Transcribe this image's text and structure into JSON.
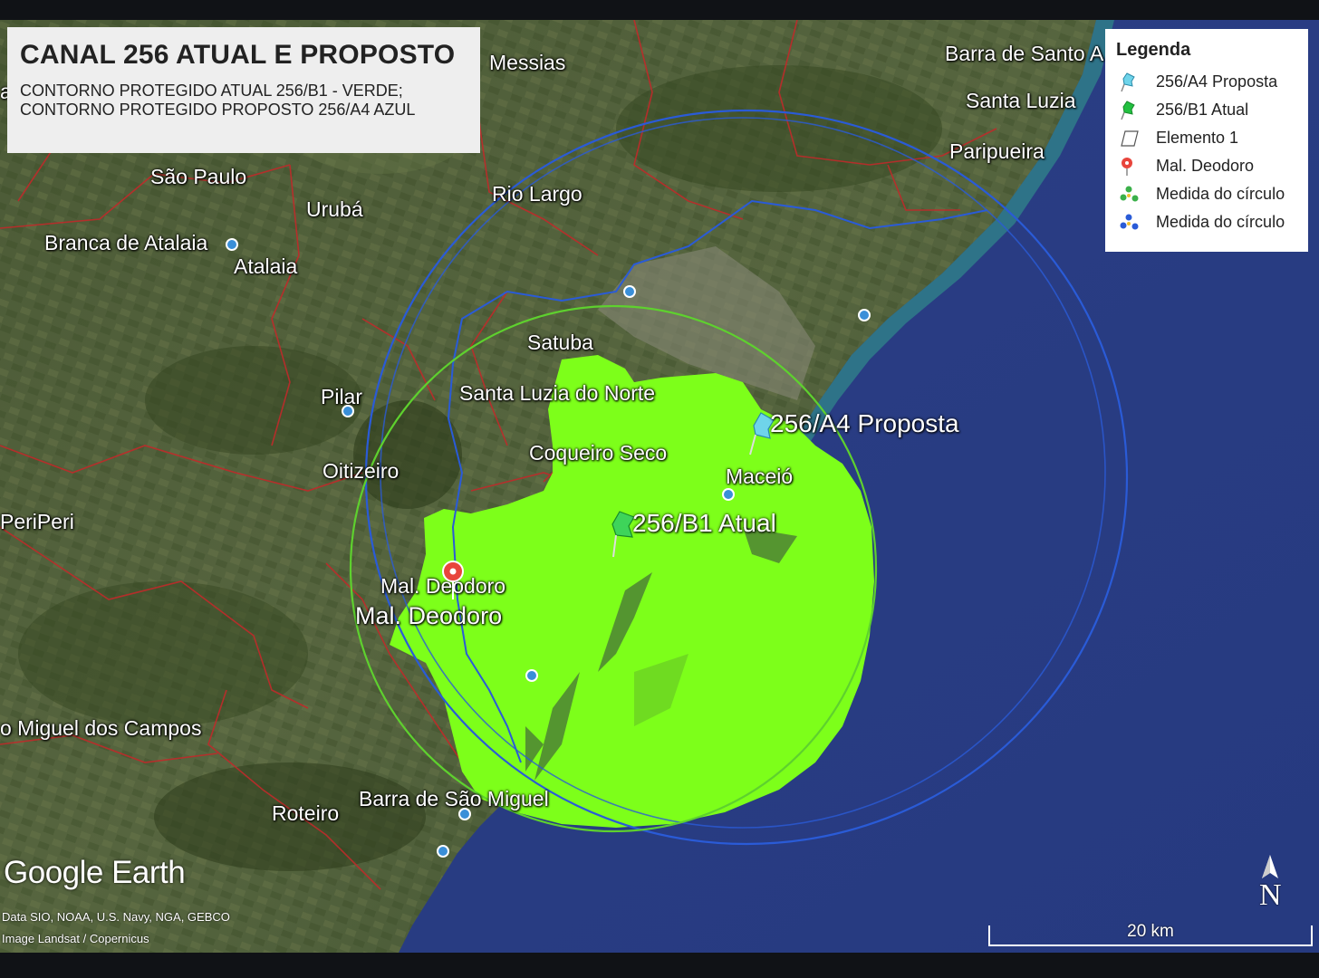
{
  "title": {
    "heading": "CANAL 256 ATUAL E PROPOSTO",
    "line1": "CONTORNO PROTEGIDO ATUAL 256/B1 - VERDE;",
    "line2": "CONTORNO PROTEGIDO PROPOSTO 256/A4 AZUL"
  },
  "legend": {
    "heading": "Legenda",
    "items": [
      {
        "label": "256/A4 Proposta",
        "icon": "cyan-pushpin-icon",
        "color": "#4fc3e0"
      },
      {
        "label": "256/B1 Atual",
        "icon": "green-pushpin-icon",
        "color": "#22c040"
      },
      {
        "label": "Elemento 1",
        "icon": "polygon-outline-icon",
        "color": "#ffffff"
      },
      {
        "label": "Mal. Deodoro",
        "icon": "red-placemark-icon",
        "color": "#e8453c"
      },
      {
        "label": "Medida do círculo",
        "icon": "green-circle-measure-icon",
        "color": "#3ab04a"
      },
      {
        "label": "Medida do círculo",
        "icon": "blue-circle-measure-icon",
        "color": "#2a5bd7"
      }
    ]
  },
  "places": {
    "messias": "Messias",
    "barra_santo": "Barra de Santo A",
    "santa_luzia": "Santa Luzia",
    "paripueira": "Paripueira",
    "sao_paulo": "São Paulo",
    "uruba": "Urubá",
    "rio_largo": "Rio Largo",
    "branca_atalaia": "Branca de Atalaia",
    "atalaia": "Atalaia",
    "satuba": "Satuba",
    "santa_luzia_norte": "Santa Luzia do Norte",
    "pilar": "Pilar",
    "coqueiro_seco": "Coqueiro Seco",
    "oitizeiro": "Oitizeiro",
    "maceio": "Maceió",
    "periperi": "PeriPeri",
    "mal_deodoro_small": "Mal. Deodoro",
    "mal_deodoro_large": "Mal. Deodoro",
    "sao_miguel_campos": "o Miguel dos Campos",
    "roteiro": "Roteiro",
    "barra_sao_miguel": "Barra de São Miguel",
    "left_fragment": "a"
  },
  "markers": {
    "proposed": "256/A4 Proposta",
    "current": "256/B1 Atual"
  },
  "branding": {
    "logo": "Google Earth",
    "data_credit": "Data SIO, NOAA, U.S. Navy, NGA, GEBCO",
    "image_credit": "Image Landsat / Copernicus"
  },
  "scale": {
    "label": "20 km"
  },
  "compass": {
    "label": "N"
  },
  "colors": {
    "green_contour": "#7dff1a",
    "blue_contour": "#2a5bd7",
    "ocean": "#2c3f8a",
    "roads": "#c02a2a"
  }
}
